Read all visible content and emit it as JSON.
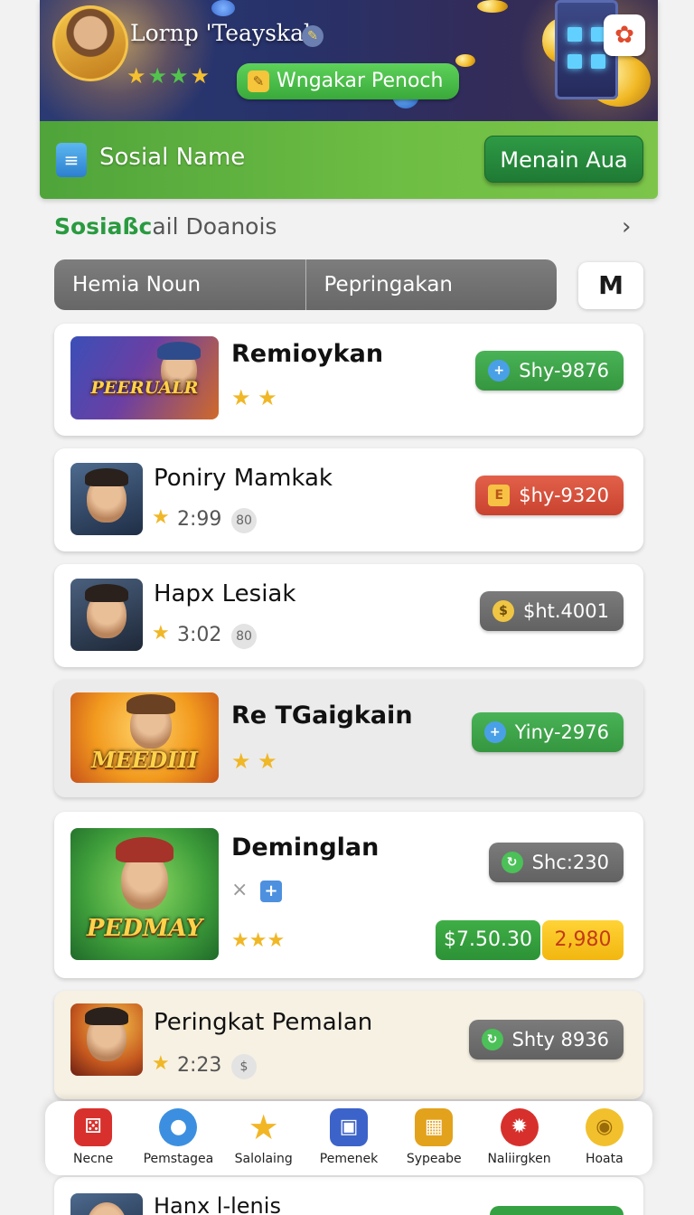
{
  "hero": {
    "player_name": "Lornp 'Teayskal",
    "badge_label": "Wngakar Penoch",
    "social_label": "Sosial Name",
    "cta_label": "Menain Aua"
  },
  "section": {
    "title_prefix": "Sosiaßc",
    "title_rest": "ail Doanois",
    "chevron": "›"
  },
  "tabs": [
    "Hemia Noun",
    "Pepringakan"
  ],
  "mail_icon": "M",
  "items": [
    {
      "name": "Remioykan",
      "thumb_text": "PEERUALR",
      "stars": "★ ★",
      "pill": "Shy-9876",
      "pill_icon": "+"
    },
    {
      "name": "Poniry Mamkak",
      "time": "2:99",
      "badge": "80",
      "pill": "$hy-9320",
      "pill_icon": "E"
    },
    {
      "name": "Hapx Lesiak",
      "time": "3:02",
      "badge": "80",
      "pill": "$ht.4001",
      "pill_icon": "$"
    },
    {
      "name": "Re TGaigkain",
      "thumb_text": "MEEDIII",
      "stars": "★ ★",
      "pill": "Yiny-2976",
      "pill_icon": "+"
    },
    {
      "name": "Deminglan",
      "thumb_text": "PEDMAY",
      "stars": "★★★",
      "pill": "Shc:230",
      "pill_icon": "↻",
      "close": "×",
      "plus": "+",
      "price_green": "$7.50.30",
      "price_yellow": "2,980"
    },
    {
      "name": "Peringkat Pemalan",
      "time": "2:23",
      "badge": "$",
      "pill": "Shty 8936",
      "pill_icon": "↻"
    }
  ],
  "nav": [
    {
      "label": "Necne",
      "icon": "dice-icon",
      "glyph": "⚄",
      "color": "#d8312d"
    },
    {
      "label": "Pemstagea",
      "icon": "blob-icon",
      "glyph": "●",
      "color": "#3c8fe0"
    },
    {
      "label": "Salolaing",
      "icon": "star-icon",
      "glyph": "★",
      "color": "#f2b625"
    },
    {
      "label": "Pemenek",
      "icon": "treasure-icon",
      "glyph": "▣",
      "color": "#3c63c9"
    },
    {
      "label": "Sypeabe",
      "icon": "crate-icon",
      "glyph": "▦",
      "color": "#e3a21c"
    },
    {
      "label": "Naliirgken",
      "icon": "gear-icon",
      "glyph": "✹",
      "color": "#d7302c"
    },
    {
      "label": "Hoata",
      "icon": "coin-icon",
      "glyph": "◉",
      "color": "#f1c02c"
    }
  ],
  "peek": {
    "name": "Hanx l-lenis"
  }
}
